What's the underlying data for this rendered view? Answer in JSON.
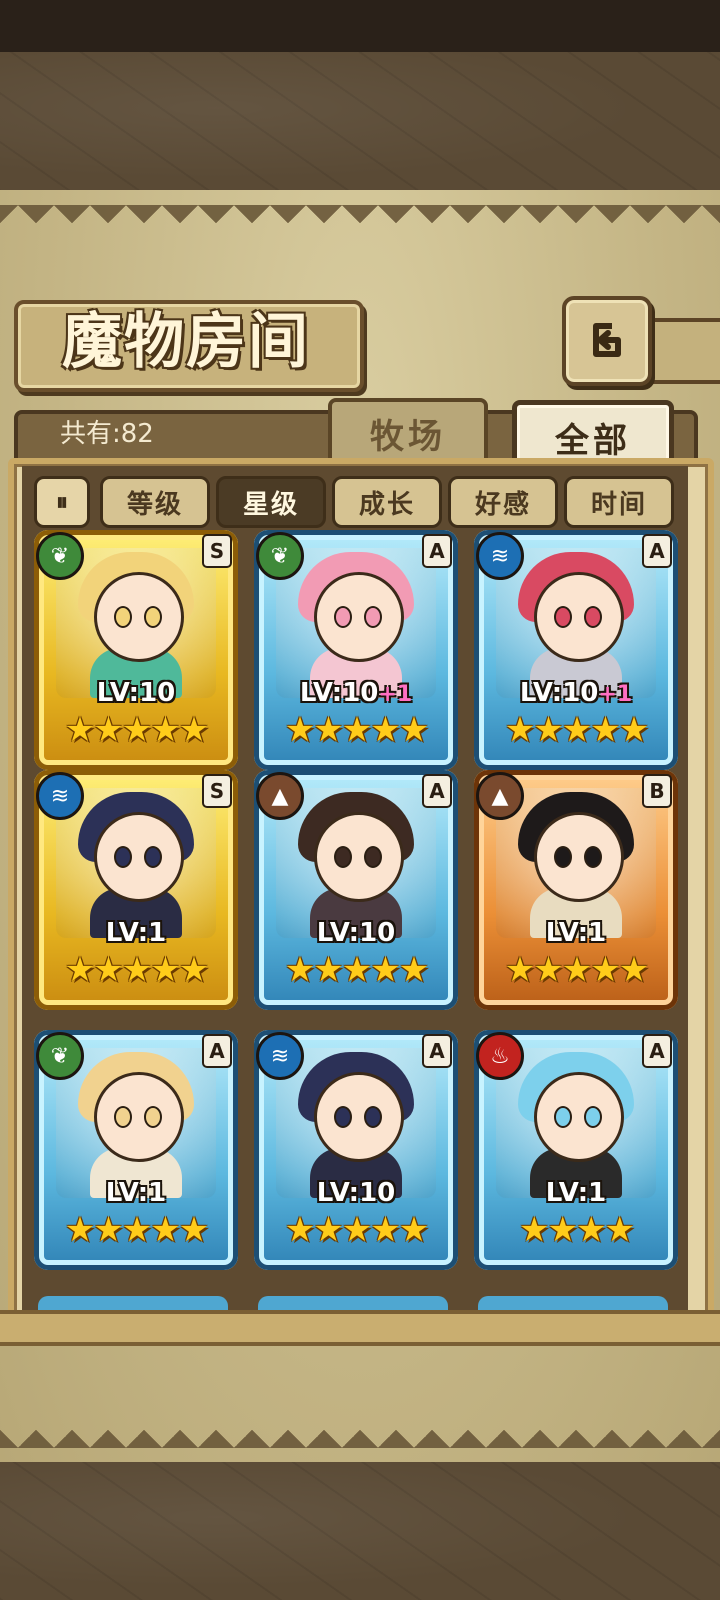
{
  "header": {
    "title": "魔物房间",
    "back_icon": "back-arrow-icon"
  },
  "summary": {
    "count_text": "共有:82"
  },
  "tabs": [
    {
      "label": "牧场",
      "active": false
    },
    {
      "label": "全部",
      "active": true
    }
  ],
  "filters": {
    "toggle_label": "⏸",
    "items": [
      {
        "label": "等级",
        "active": false
      },
      {
        "label": "星级",
        "active": true
      },
      {
        "label": "成长",
        "active": false
      },
      {
        "label": "好感",
        "active": false
      },
      {
        "label": "时间",
        "active": false
      }
    ]
  },
  "cards": [
    {
      "frame": "gold",
      "element": "plant",
      "rank": "S",
      "level": "LV:10",
      "plus": "",
      "stars": "★★★★★",
      "hair": "#f2d37a",
      "outfit": "#4fb99a"
    },
    {
      "frame": "blue",
      "element": "plant",
      "rank": "A",
      "level": "LV:10",
      "plus": "+1",
      "stars": "★★★★★",
      "hair": "#f29bb4",
      "outfit": "#f4c6d2"
    },
    {
      "frame": "blue",
      "element": "water",
      "rank": "A",
      "level": "LV:10",
      "plus": "+1",
      "stars": "★★★★★",
      "hair": "#d94a62",
      "outfit": "#c9c9d3"
    },
    {
      "frame": "gold",
      "element": "water",
      "rank": "S",
      "level": "LV:1",
      "plus": "",
      "stars": "★★★★★",
      "hair": "#2c3157",
      "outfit": "#2a2c44"
    },
    {
      "frame": "blue",
      "element": "earth",
      "rank": "A",
      "level": "LV:10",
      "plus": "",
      "stars": "★★★★★",
      "hair": "#3d2a22",
      "outfit": "#4a3a40"
    },
    {
      "frame": "orange",
      "element": "earth",
      "rank": "B",
      "level": "LV:1",
      "plus": "",
      "stars": "★★★★★",
      "hair": "#1e1a1a",
      "outfit": "#e8dcc0"
    },
    {
      "frame": "blue",
      "element": "plant",
      "rank": "A",
      "level": "LV:1",
      "plus": "",
      "stars": "★★★★★",
      "hair": "#f1d28f",
      "outfit": "#efe6d2"
    },
    {
      "frame": "blue",
      "element": "water",
      "rank": "A",
      "level": "LV:10",
      "plus": "",
      "stars": "★★★★★",
      "hair": "#2c3157",
      "outfit": "#2a2c44"
    },
    {
      "frame": "blue",
      "element": "fire",
      "rank": "A",
      "level": "LV:1",
      "plus": "",
      "stars": "★★★★",
      "hair": "#7dd0ec",
      "outfit": "#2a2a2a"
    }
  ],
  "element_icons": {
    "plant": "leaf-icon",
    "water": "water-wave-icon",
    "earth": "mountain-icon",
    "fire": "flame-icon"
  }
}
